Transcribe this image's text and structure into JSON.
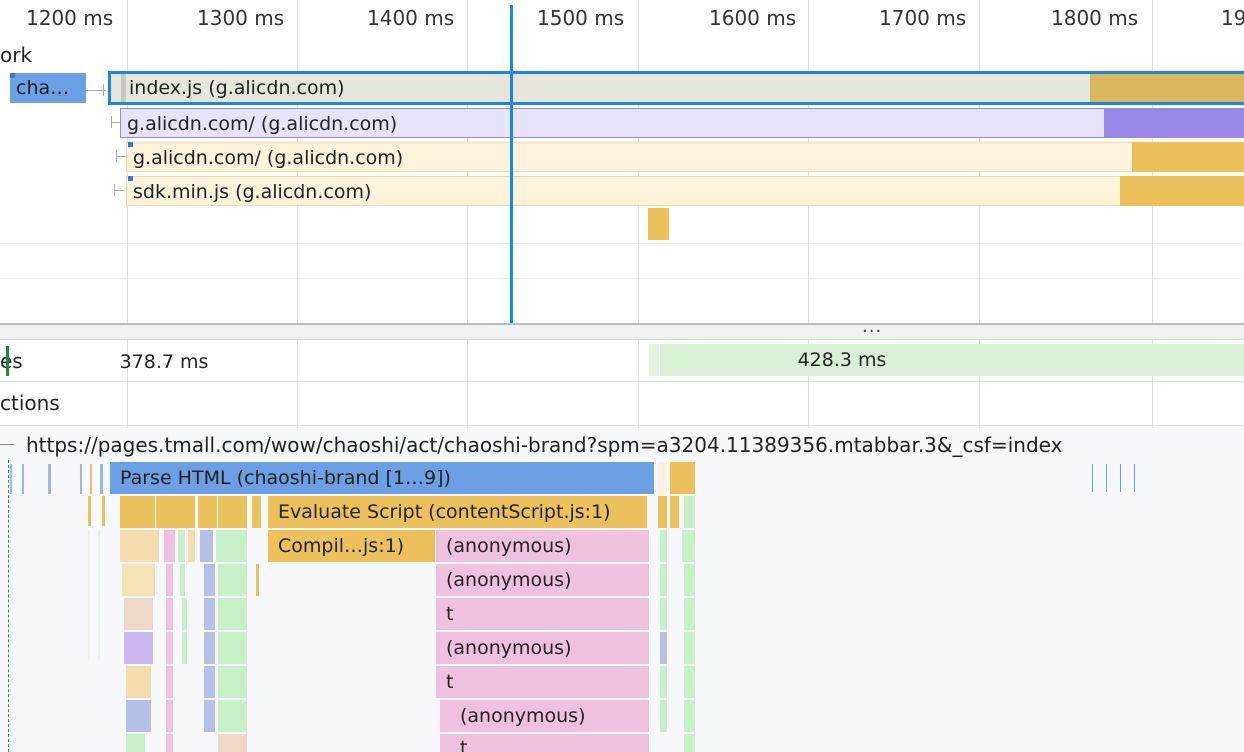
{
  "colors": {
    "selection": "#1a87e0",
    "script": "#ecc15b",
    "script_light": "#fdf3dd",
    "style": "#9a86e6",
    "style_light": "#e7e3fb",
    "parse": "#6c9fe4",
    "js_call": "#f0c1de",
    "gc_green": "#c7efc8",
    "frame_green": "#d9f0d7"
  },
  "ruler": {
    "ticks": [
      "1200 ms",
      "1300 ms",
      "1400 ms",
      "1500 ms",
      "1600 ms",
      "1700 ms",
      "1800 ms",
      "19"
    ]
  },
  "network": {
    "track_label": "ork",
    "requests": [
      {
        "label": "cha…"
      },
      {
        "label": "index.js (g.alicdn.com)"
      },
      {
        "label": "g.alicdn.com/ (g.alicdn.com)"
      },
      {
        "label": "g.alicdn.com/ (g.alicdn.com)"
      },
      {
        "label": "sdk.min.js (g.alicdn.com)"
      }
    ]
  },
  "splitter": {
    "label": "..."
  },
  "frames": {
    "track_label": "es",
    "items": [
      {
        "label": "378.7 ms"
      },
      {
        "label": "428.3 ms"
      }
    ]
  },
  "interactions": {
    "track_label": "ctions"
  },
  "main": {
    "url": "https://pages.tmall.com/wow/chaoshi/act/chaoshi-brand?spm=a3204.11389356.mtabbar.3&_csf=index",
    "flames": [
      {
        "label": "Parse HTML (chaoshi-brand [1…9])"
      },
      {
        "label": "Evaluate Script (contentScript.js:1)"
      },
      {
        "label": "Compil…js:1)"
      },
      {
        "label": "(anonymous)"
      },
      {
        "label": "(anonymous)"
      },
      {
        "label": "t"
      },
      {
        "label": "(anonymous)"
      },
      {
        "label": "t"
      },
      {
        "label": "(anonymous)"
      },
      {
        "label": "t"
      }
    ]
  }
}
